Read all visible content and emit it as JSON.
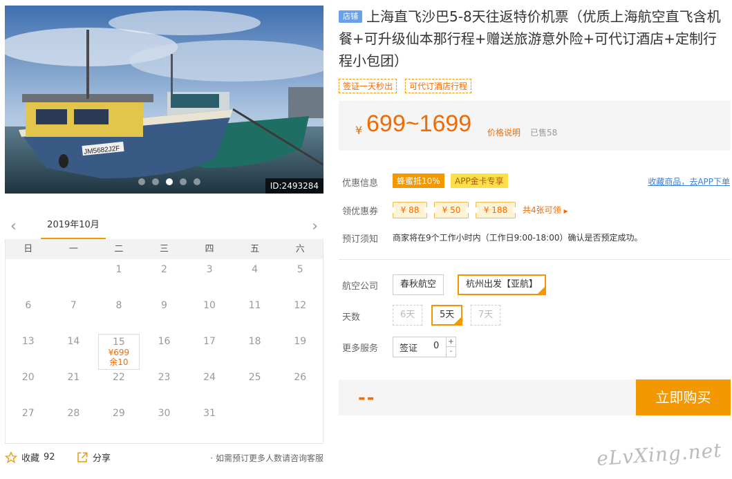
{
  "gallery": {
    "photo_id": "ID:2493284",
    "dots": 5,
    "active_dot": 3,
    "boat_hull_text": "JM5682J2F"
  },
  "calendar": {
    "month": "2019年10月",
    "weekdays": [
      "日",
      "一",
      "二",
      "三",
      "四",
      "五",
      "六"
    ],
    "leading_blanks": 2,
    "days": 31,
    "available": {
      "day": 15,
      "price": "¥699",
      "stock": "余10"
    }
  },
  "footer": {
    "favorite_label": "收藏",
    "favorite_count": "92",
    "share_label": "分享",
    "consult_text": "· 如需预订更多人数请咨询客服"
  },
  "product": {
    "shop_tag": "店铺",
    "title": "上海直飞沙巴5-8天往返特价机票（优质上海航空直飞含机餐+可升级仙本那行程+赠送旅游意外险+可代订酒店+定制行程小包团）",
    "tags": [
      "签证一天秒出",
      "可代订酒店行程"
    ]
  },
  "price": {
    "currency": "¥",
    "range": "699~1699",
    "explain_label": "价格说明",
    "sold_label": "已售58"
  },
  "promo": {
    "label": "优惠信息",
    "badge1": "蜂蜜抵10%",
    "badge2": "APP金卡专享",
    "app_link": "收藏商品，去APP下单"
  },
  "coupons": {
    "label": "领优惠券",
    "items": [
      "¥ 88",
      "¥ 50",
      "¥ 188"
    ],
    "more": "共4张可领"
  },
  "notice": {
    "label": "预订须知",
    "text": "商家将在9个工作小时内（工作日9:00-18:00）确认是否预定成功。"
  },
  "options": {
    "airline_label": "航空公司",
    "airlines": [
      "春秋航空",
      "杭州出发【亚航】"
    ],
    "days_label": "天数",
    "days": [
      "6天",
      "5天",
      "7天"
    ],
    "service_label": "更多服务",
    "service_name": "签证",
    "service_qty": "0",
    "plus": "+",
    "minus": "-"
  },
  "buy": {
    "total": "--",
    "button": "立即购买"
  },
  "watermark": "eLvXing.net",
  "colors": {
    "accent": "#f39800",
    "price": "#f36b00",
    "link": "#3d7fd6",
    "shop_tag": "#6aa0e8"
  }
}
